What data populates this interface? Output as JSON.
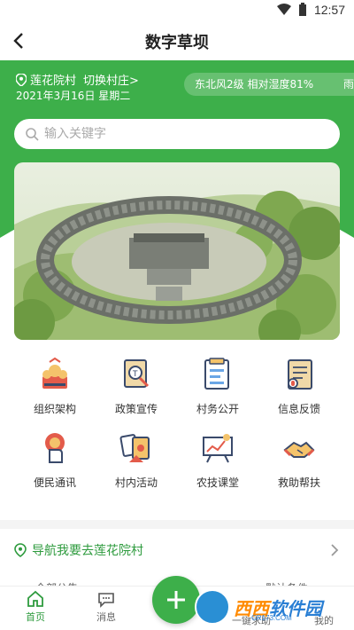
{
  "status_bar": {
    "time": "12:57"
  },
  "header": {
    "title": "数字草坝"
  },
  "location": {
    "village": "莲花院村",
    "switch_label": "切换村庄>"
  },
  "date": "2021年3月16日 星期二",
  "weather": {
    "text": "东北风2级 相对湿度81%",
    "extra": "雨"
  },
  "search": {
    "placeholder": "输入关键字"
  },
  "grid": {
    "items": [
      {
        "label": "组织架构",
        "icon": "org-structure-icon"
      },
      {
        "label": "政策宣传",
        "icon": "policy-icon"
      },
      {
        "label": "村务公开",
        "icon": "village-affairs-icon"
      },
      {
        "label": "信息反馈",
        "icon": "feedback-icon"
      },
      {
        "label": "便民通讯",
        "icon": "contact-icon"
      },
      {
        "label": "村内活动",
        "icon": "activity-icon"
      },
      {
        "label": "农技课堂",
        "icon": "classroom-icon"
      },
      {
        "label": "救助帮扶",
        "icon": "help-icon"
      }
    ]
  },
  "navigation": {
    "text": "导航我要去莲花院村"
  },
  "partial_row": {
    "left": "全部公告",
    "right": "默认条件"
  },
  "tabbar": {
    "home": "首页",
    "messages": "消息",
    "one_click": "一键求助",
    "mine": "我的"
  },
  "watermark": {
    "name_part1": "西西",
    "name_part2": "软件园",
    "domain": "CR173.COM"
  },
  "colors": {
    "brand_green": "#3daf4a",
    "nav_green": "#2e9b3e"
  }
}
